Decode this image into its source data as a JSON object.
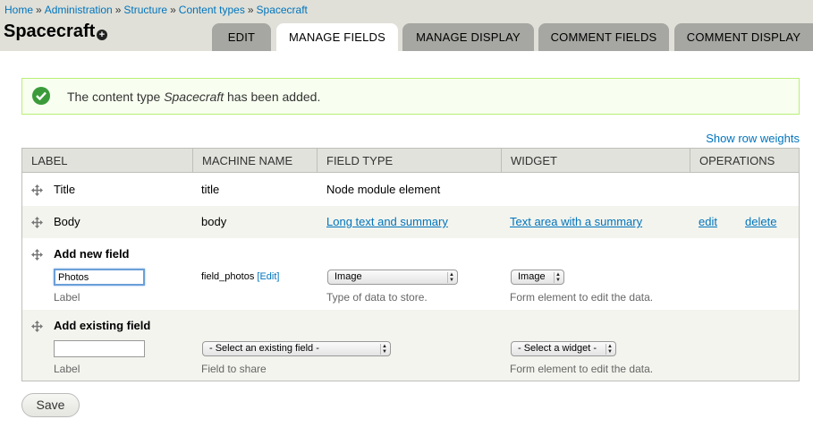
{
  "breadcrumb": [
    "Home",
    "Administration",
    "Structure",
    "Content types",
    "Spacecraft"
  ],
  "breadcrumb_sep": "»",
  "page_title": "Spacecraft",
  "tabs": [
    {
      "label": "Edit",
      "active": false
    },
    {
      "label": "Manage fields",
      "active": true
    },
    {
      "label": "Manage display",
      "active": false
    },
    {
      "label": "Comment fields",
      "active": false
    },
    {
      "label": "Comment display",
      "active": false
    }
  ],
  "message": {
    "before": "The content type ",
    "type_name": "Spacecraft",
    "after": " has been added."
  },
  "show_row_weights": "Show row weights",
  "table": {
    "headers": [
      "Label",
      "Machine name",
      "Field type",
      "Widget",
      "Operations"
    ],
    "rows": [
      {
        "label": "Title",
        "machine": "title",
        "type": "Node module element"
      },
      {
        "label": "Body",
        "machine": "body",
        "type": "Long text and summary",
        "widget": "Text area with a summary",
        "edit": "edit",
        "delete": "delete"
      }
    ],
    "add_new": {
      "title": "Add new field",
      "label_value": "Photos",
      "label_desc": "Label",
      "machine_value": "field_photos",
      "machine_edit": "[Edit]",
      "type_value": "Image",
      "type_desc": "Type of data to store.",
      "widget_value": "Image",
      "widget_desc": "Form element to edit the data."
    },
    "add_existing": {
      "title": "Add existing field",
      "label_value": "",
      "label_desc": "Label",
      "field_value": "- Select an existing field -",
      "field_desc": "Field to share",
      "widget_value": "- Select a widget -",
      "widget_desc": "Form element to edit the data."
    }
  },
  "save_label": "Save",
  "colors": {
    "link": "#0074bd",
    "header_bg": "#e0e0d8",
    "tab_bg": "#a6a7a2",
    "message_bg": "#f8fff0",
    "message_border": "#bbee77",
    "success": "#3b9b3b"
  }
}
